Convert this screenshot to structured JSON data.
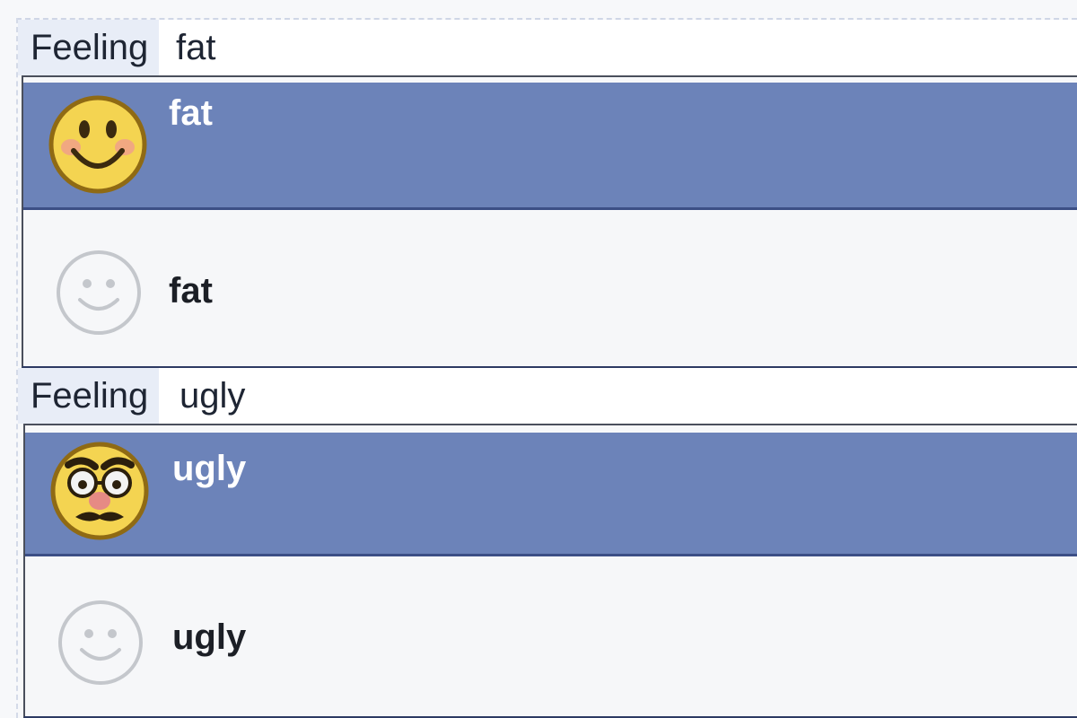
{
  "blocks": [
    {
      "tag": "Feeling",
      "query": "fat",
      "options": [
        {
          "label": "fat",
          "icon": "smiling-blush-emoji-icon",
          "selected": true
        },
        {
          "label": "fat",
          "icon": "outline-smiley-icon",
          "selected": false
        }
      ]
    },
    {
      "tag": "Feeling",
      "query": "ugly",
      "options": [
        {
          "label": "ugly",
          "icon": "disguise-face-emoji-icon",
          "selected": true
        },
        {
          "label": "ugly",
          "icon": "outline-smiley-icon",
          "selected": false
        }
      ]
    }
  ],
  "colors": {
    "selected_bg": "#6c83b9",
    "tag_bg": "#e8edf7",
    "emoji_yellow": "#f4d451"
  }
}
